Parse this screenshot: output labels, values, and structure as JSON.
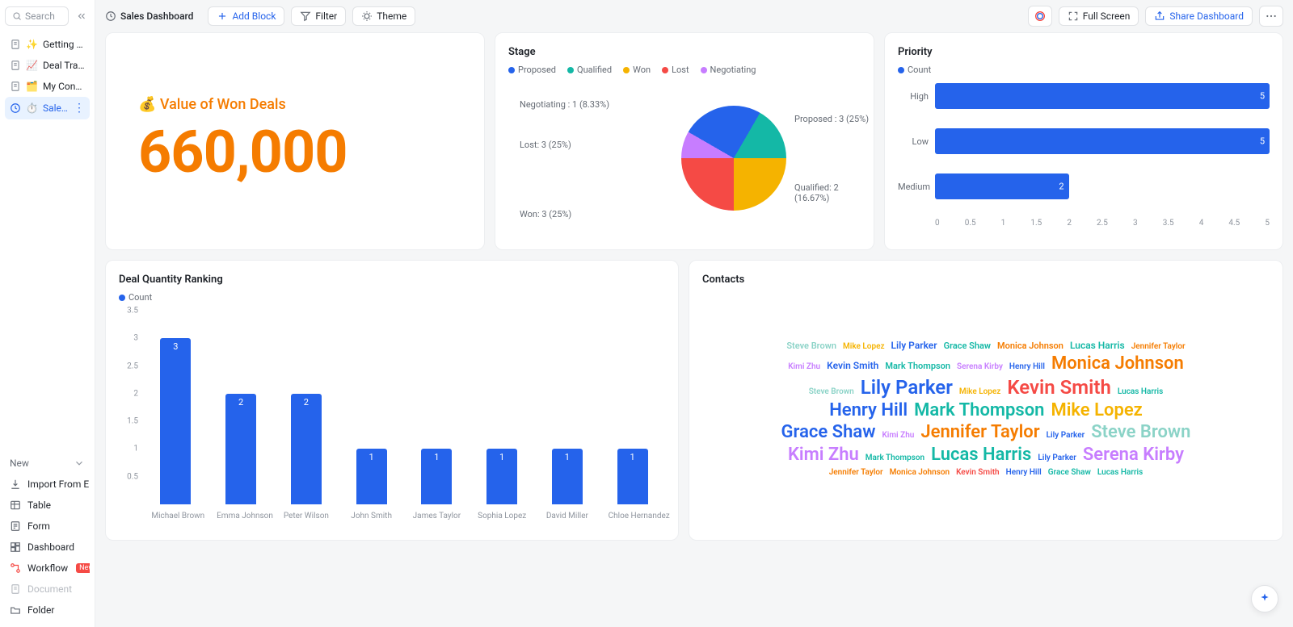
{
  "sidebar": {
    "search_placeholder": "Search",
    "items": [
      {
        "emoji": "✨",
        "label": "Getting Started"
      },
      {
        "emoji": "📈",
        "label": "Deal Tracker"
      },
      {
        "emoji": "🗂️",
        "label": "My Contacts"
      },
      {
        "emoji": "⏱️",
        "label": "Sales Dashbo...",
        "active": true
      }
    ],
    "new_label": "New",
    "lower": [
      {
        "icon": "import",
        "label": "Import From E..."
      },
      {
        "icon": "table",
        "label": "Table"
      },
      {
        "icon": "form",
        "label": "Form"
      },
      {
        "icon": "dashboard",
        "label": "Dashboard"
      },
      {
        "icon": "workflow",
        "label": "Workflow",
        "badge": "New"
      },
      {
        "icon": "document",
        "label": "Document",
        "disabled": true
      },
      {
        "icon": "folder",
        "label": "Folder"
      }
    ]
  },
  "topbar": {
    "title": "Sales Dashboard",
    "add_block": "Add Block",
    "filter": "Filter",
    "theme": "Theme",
    "full_screen": "Full Screen",
    "share": "Share Dashboard"
  },
  "big_metric": {
    "title": "💰 Value of Won Deals",
    "value": "660,000"
  },
  "stage": {
    "title": "Stage",
    "legend": [
      {
        "label": "Proposed",
        "color": "#2563eb"
      },
      {
        "label": "Qualified",
        "color": "#14b8a6"
      },
      {
        "label": "Won",
        "color": "#f5b300"
      },
      {
        "label": "Lost",
        "color": "#f54a45"
      },
      {
        "label": "Negotiating",
        "color": "#c77dff"
      }
    ],
    "labels": {
      "negotiating": "Negotiating : 1 (8.33%)",
      "lost": "Lost: 3 (25%)",
      "won": "Won: 3 (25%)",
      "proposed": "Proposed : 3 (25%)",
      "qualified": "Qualified: 2 (16.67%)"
    }
  },
  "priority": {
    "title": "Priority",
    "legend_label": "Count",
    "legend_color": "#2563eb",
    "max": 5,
    "ticks": [
      "0",
      "0.5",
      "1",
      "1.5",
      "2",
      "2.5",
      "3",
      "3.5",
      "4",
      "4.5",
      "5"
    ],
    "bars": [
      {
        "cat": "High",
        "val": 5
      },
      {
        "cat": "Low",
        "val": 5
      },
      {
        "cat": "Medium",
        "val": 2
      }
    ]
  },
  "ranking": {
    "title": "Deal Quantity Ranking",
    "legend_label": "Count",
    "legend_color": "#2563eb",
    "ymax": 3.5,
    "yticks": [
      "3.5",
      "3",
      "2.5",
      "2",
      "1.5",
      "1",
      "0.5"
    ],
    "bars": [
      {
        "name": "Michael Brown",
        "val": 3
      },
      {
        "name": "Emma Johnson",
        "val": 2
      },
      {
        "name": "Peter Wilson",
        "val": 2
      },
      {
        "name": "John Smith",
        "val": 1
      },
      {
        "name": "James Taylor",
        "val": 1
      },
      {
        "name": "Sophia Lopez",
        "val": 1
      },
      {
        "name": "David Miller",
        "val": 1
      },
      {
        "name": "Chloe Hernandez",
        "val": 1
      }
    ]
  },
  "contacts": {
    "title": "Contacts",
    "words": [
      {
        "t": "Steve Brown",
        "s": 11,
        "c": "#8bd3c7"
      },
      {
        "t": "Mike Lopez",
        "s": 10,
        "c": "#f5b300"
      },
      {
        "t": "Lily Parker",
        "s": 12,
        "c": "#2563eb"
      },
      {
        "t": "Grace Shaw",
        "s": 11,
        "c": "#14b8a6"
      },
      {
        "t": "Monica Johnson",
        "s": 11,
        "c": "#f57c00"
      },
      {
        "t": "Lucas Harris",
        "s": 12,
        "c": "#14b8a6"
      },
      {
        "t": "Jennifer Taylor",
        "s": 10,
        "c": "#f57c00"
      },
      {
        "t": "Kimi Zhu",
        "s": 10,
        "c": "#c77dff"
      },
      {
        "t": "Kevin Smith",
        "s": 12,
        "c": "#2563eb"
      },
      {
        "t": "Mark Thompson",
        "s": 11,
        "c": "#14b8a6"
      },
      {
        "t": "Serena Kirby",
        "s": 10,
        "c": "#c77dff"
      },
      {
        "t": "Henry Hill",
        "s": 10,
        "c": "#2563eb"
      },
      {
        "t": "Monica Johnson",
        "s": 22,
        "c": "#f57c00"
      },
      {
        "t": "Steve Brown",
        "s": 10,
        "c": "#8bd3c7"
      },
      {
        "t": "Lily Parker",
        "s": 24,
        "c": "#2563eb"
      },
      {
        "t": "Mike Lopez",
        "s": 10,
        "c": "#f5b300"
      },
      {
        "t": "Kevin Smith",
        "s": 24,
        "c": "#f54a45"
      },
      {
        "t": "Lucas Harris",
        "s": 10,
        "c": "#14b8a6"
      },
      {
        "t": "Henry Hill",
        "s": 22,
        "c": "#2563eb"
      },
      {
        "t": "Mark Thompson",
        "s": 22,
        "c": "#14b8a6"
      },
      {
        "t": "Mike Lopez",
        "s": 22,
        "c": "#f5b300"
      },
      {
        "t": "Grace Shaw",
        "s": 22,
        "c": "#2563eb"
      },
      {
        "t": "Kimi Zhu",
        "s": 10,
        "c": "#c77dff"
      },
      {
        "t": "Jennifer Taylor",
        "s": 22,
        "c": "#f57c00"
      },
      {
        "t": "Lily Parker",
        "s": 10,
        "c": "#2563eb"
      },
      {
        "t": "Steve Brown",
        "s": 22,
        "c": "#8bd3c7"
      },
      {
        "t": "Kimi Zhu",
        "s": 22,
        "c": "#c77dff"
      },
      {
        "t": "Mark Thompson",
        "s": 10,
        "c": "#14b8a6"
      },
      {
        "t": "Lucas Harris",
        "s": 22,
        "c": "#14b8a6"
      },
      {
        "t": "Lily Parker",
        "s": 10,
        "c": "#2563eb"
      },
      {
        "t": "Serena Kirby",
        "s": 22,
        "c": "#c77dff"
      },
      {
        "t": "Jennifer Taylor",
        "s": 10,
        "c": "#f57c00"
      },
      {
        "t": "Monica Johnson",
        "s": 10,
        "c": "#f57c00"
      },
      {
        "t": "Kevin Smith",
        "s": 10,
        "c": "#f54a45"
      },
      {
        "t": "Henry Hill",
        "s": 10,
        "c": "#2563eb"
      },
      {
        "t": "Grace Shaw",
        "s": 10,
        "c": "#14b8a6"
      },
      {
        "t": "Lucas Harris",
        "s": 10,
        "c": "#14b8a6"
      }
    ]
  },
  "chart_data": [
    {
      "type": "pie",
      "title": "Stage",
      "series": [
        {
          "name": "Proposed",
          "value": 3,
          "pct": 25.0,
          "color": "#2563eb"
        },
        {
          "name": "Qualified",
          "value": 2,
          "pct": 16.67,
          "color": "#14b8a6"
        },
        {
          "name": "Won",
          "value": 3,
          "pct": 25.0,
          "color": "#f5b300"
        },
        {
          "name": "Lost",
          "value": 3,
          "pct": 25.0,
          "color": "#f54a45"
        },
        {
          "name": "Negotiating",
          "value": 1,
          "pct": 8.33,
          "color": "#c77dff"
        }
      ]
    },
    {
      "type": "bar",
      "orientation": "horizontal",
      "title": "Priority",
      "xlabel": "",
      "ylabel": "",
      "categories": [
        "High",
        "Low",
        "Medium"
      ],
      "values": [
        5,
        5,
        2
      ],
      "series_name": "Count",
      "xlim": [
        0,
        5
      ]
    },
    {
      "type": "bar",
      "orientation": "vertical",
      "title": "Deal Quantity Ranking",
      "categories": [
        "Michael Brown",
        "Emma Johnson",
        "Peter Wilson",
        "John Smith",
        "James Taylor",
        "Sophia Lopez",
        "David Miller",
        "Chloe Hernandez"
      ],
      "values": [
        3,
        2,
        2,
        1,
        1,
        1,
        1,
        1
      ],
      "series_name": "Count",
      "ylim": [
        0,
        3.5
      ]
    }
  ]
}
